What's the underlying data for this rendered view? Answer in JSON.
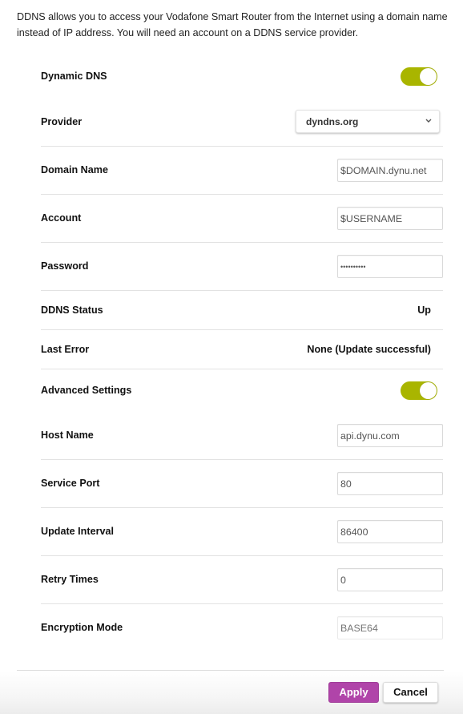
{
  "intro": {
    "text": "DDNS allows you to access your Vodafone Smart Router from the Internet using a domain name instead of IP address. You will need an account on a DDNS service provider."
  },
  "colors": {
    "toggle_on": "#a9b500",
    "apply": "#b044a9",
    "top_text": "#e60000"
  },
  "form": {
    "dynamic_dns": {
      "label": "Dynamic DNS",
      "enabled": true
    },
    "provider": {
      "label": "Provider",
      "selected": "dyndns.org",
      "icon": "chevron-down-icon"
    },
    "domain_name": {
      "label": "Domain Name",
      "value": "$DOMAIN.dynu.net"
    },
    "account": {
      "label": "Account",
      "value": "$USERNAME"
    },
    "password": {
      "label": "Password",
      "value": "••••••••••"
    },
    "ddns_status": {
      "label": "DDNS Status",
      "value": "Up"
    },
    "last_error": {
      "label": "Last Error",
      "value": "None (Update successful)"
    },
    "advanced_settings": {
      "label": "Advanced Settings",
      "enabled": true
    },
    "host_name": {
      "label": "Host Name",
      "value": "api.dynu.com"
    },
    "service_port": {
      "label": "Service Port",
      "value": "80"
    },
    "update_interval": {
      "label": "Update Interval",
      "value": "86400"
    },
    "retry_times": {
      "label": "Retry Times",
      "value": "0"
    },
    "encryption_mode": {
      "label": "Encryption Mode",
      "placeholder": "BASE64",
      "disabled": true
    }
  },
  "buttons": {
    "apply": "Apply",
    "cancel": "Cancel"
  }
}
